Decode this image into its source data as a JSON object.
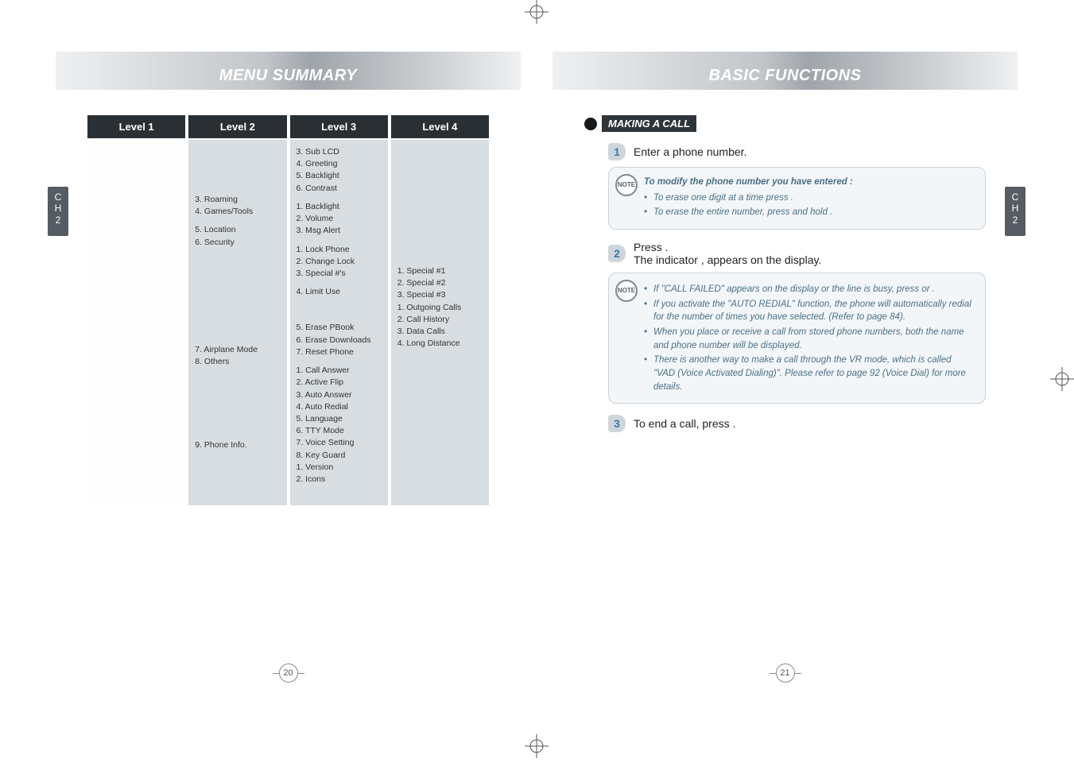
{
  "left": {
    "title": "MENU SUMMARY",
    "ch_label": "C\nH\n2",
    "headers": [
      "Level 1",
      "Level 2",
      "Level 3",
      "Level 4"
    ],
    "col1": [],
    "col2": [
      {
        "spacer": "lg"
      },
      {
        "text": "3. Roaming"
      },
      {
        "text": "4. Games/Tools"
      },
      {
        "spacer": "sm"
      },
      {
        "text": "5. Location"
      },
      {
        "text": "6. Security"
      },
      {
        "spacer": "lg"
      },
      {
        "spacer": "lg"
      },
      {
        "text": "7. Airplane Mode"
      },
      {
        "text": "8. Others"
      },
      {
        "spacer": "lg"
      },
      {
        "spacer": "md"
      },
      {
        "text": "9. Phone Info."
      }
    ],
    "col3": [
      {
        "text": "3. Sub LCD"
      },
      {
        "text": "4. Greeting"
      },
      {
        "text": "5. Backlight"
      },
      {
        "text": "6. Contrast"
      },
      {
        "spacer": "sm"
      },
      {
        "text": "1. Backlight"
      },
      {
        "text": "2. Volume"
      },
      {
        "text": "3. Msg Alert"
      },
      {
        "spacer": "sm"
      },
      {
        "text": "1. Lock Phone"
      },
      {
        "text": "2. Change Lock"
      },
      {
        "text": "3. Special #'s"
      },
      {
        "spacer": "sm"
      },
      {
        "text": "4. Limit Use"
      },
      {
        "spacer": "md"
      },
      {
        "text": "5. Erase PBook"
      },
      {
        "text": "6. Erase Downloads"
      },
      {
        "text": "7. Reset Phone"
      },
      {
        "spacer": "sm"
      },
      {
        "text": "1. Call Answer"
      },
      {
        "text": "2. Active Flip"
      },
      {
        "text": "3. Auto Answer"
      },
      {
        "text": "4. Auto Redial"
      },
      {
        "text": "5. Language"
      },
      {
        "text": "6. TTY Mode"
      },
      {
        "text": "7. Voice Setting"
      },
      {
        "text": "8. Key Guard"
      },
      {
        "text": "1. Version"
      },
      {
        "text": "2. Icons"
      }
    ],
    "col4": [
      {
        "spacer": "lg"
      },
      {
        "spacer": "lg"
      },
      {
        "spacer": "md"
      },
      {
        "text": "1. Special #1"
      },
      {
        "text": "2. Special #2"
      },
      {
        "text": "3. Special #3"
      },
      {
        "text": "1. Outgoing Calls"
      },
      {
        "text": "2. Call History"
      },
      {
        "text": "3. Data Calls"
      },
      {
        "text": "4. Long Distance"
      }
    ],
    "page_number": "20"
  },
  "right": {
    "title": "BASIC FUNCTIONS",
    "ch_label": "C\nH\n2",
    "section": "MAKING A CALL",
    "step1": "Enter a phone number.",
    "note1_title": "To modify the phone number you have entered :",
    "note1_items": [
      "To erase one digit at a time press        .",
      "To erase the entire number, press and hold        ."
    ],
    "step2_a": "Press       .",
    "step2_b": "The indicator        , appears on the display.",
    "note2_items": [
      "If \"CALL FAILED\" appears on the display or the line is busy, press       or       .",
      "If you activate the \"AUTO REDIAL\" function, the phone will automatically redial for the number of times you have selected. (Refer to page 84).",
      "When you place or receive a call from stored phone numbers, both the name and phone number will be displayed.",
      "There is another way to make a call through the VR mode, which is called \"VAD (Voice Activated Dialing)\". Please refer to page 92 (Voice Dial) for more details."
    ],
    "step3": "To end a call, press       .",
    "page_number": "21"
  }
}
